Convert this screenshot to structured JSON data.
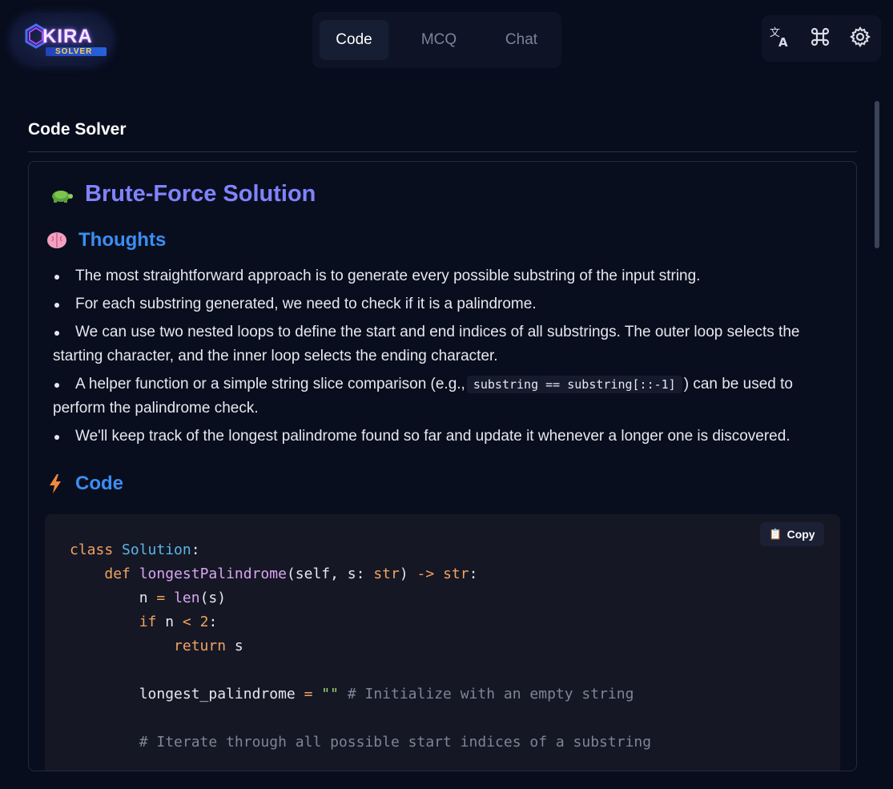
{
  "header": {
    "logo_text": "KIRA",
    "logo_sub": "SOLVER",
    "tabs": [
      {
        "label": "Code",
        "active": true
      },
      {
        "label": "MCQ",
        "active": false
      },
      {
        "label": "Chat",
        "active": false
      }
    ],
    "tools": [
      "translate-icon",
      "command-icon",
      "gear-icon"
    ]
  },
  "main": {
    "section_title": "Code Solver",
    "solution_heading": "Brute-Force Solution",
    "thoughts_heading": "Thoughts",
    "bullets": [
      "The most straightforward approach is to generate every possible substring of the input string.",
      "For each substring generated, we need to check if it is a palindrome.",
      "We can use two nested loops to define the start and end indices of all substrings. The outer loop selects the starting character, and the inner loop selects the ending character.",
      "A helper function or a simple string slice comparison (e.g.,",
      "We'll keep track of the longest palindrome found so far and update it whenever a longer one is discovered."
    ],
    "bullet4_code": "substring == substring[::-1]",
    "bullet4_tail": ") can be used to perform the palindrome check.",
    "code_heading": "Code",
    "copy_label": "Copy",
    "code_lines": [
      "class Solution:",
      "    def longestPalindrome(self, s: str) -> str:",
      "        n = len(s)",
      "        if n < 2:",
      "            return s",
      "",
      "        longest_palindrome = \"\" # Initialize with an empty string",
      "",
      "        # Iterate through all possible start indices of a substring"
    ]
  },
  "colors": {
    "background": "#080d1d",
    "accent_heading": "#8083ff",
    "subheading": "#3b8ef3",
    "keyword": "#f0a460",
    "class_name": "#5cb6e6",
    "function_name": "#d8a6f0",
    "string": "#9ad46a",
    "comment": "#7d8597"
  }
}
